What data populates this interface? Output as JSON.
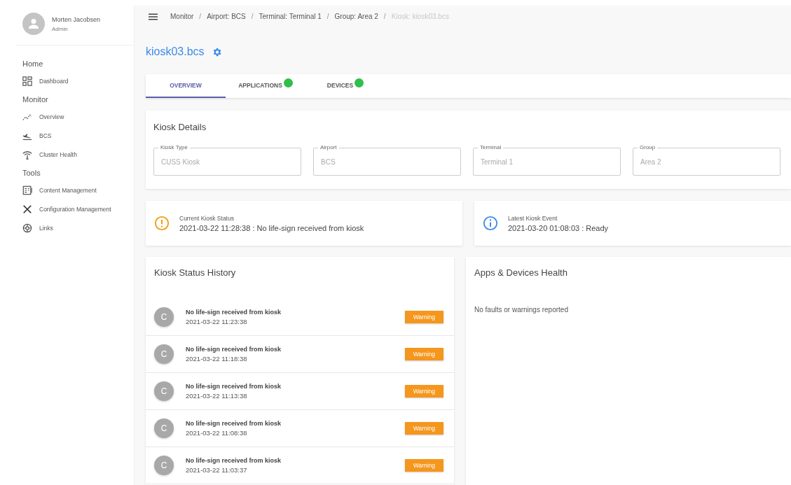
{
  "user": {
    "name": "Morten Jacobsen",
    "role": "Admin"
  },
  "sidebar": {
    "sections": [
      {
        "label": "Home",
        "items": [
          {
            "label": "Dashboard"
          }
        ]
      },
      {
        "label": "Monitor",
        "items": [
          {
            "label": "Overview"
          },
          {
            "label": "BCS"
          },
          {
            "label": "Cluster Health"
          }
        ]
      },
      {
        "label": "Tools",
        "items": [
          {
            "label": "Content Management"
          },
          {
            "label": "Configuration Management"
          },
          {
            "label": "Links"
          }
        ]
      }
    ]
  },
  "breadcrumb": [
    {
      "label": "Monitor",
      "current": false
    },
    {
      "separator": "/",
      "label": "Airport: BCS",
      "current": false
    },
    {
      "separator": "/",
      "label": "Terminal: Terminal 1",
      "current": false
    },
    {
      "separator": "/",
      "label": "Group: Area 2",
      "current": false
    },
    {
      "separator": "/",
      "label": "Kiosk: kiosk03.bcs",
      "current": true
    }
  ],
  "title": "kiosk03.bcs",
  "tabs": [
    {
      "label": "OVERVIEW",
      "selected": true,
      "dot": false
    },
    {
      "label": "APPLICATIONS",
      "selected": false,
      "dot": true
    },
    {
      "label": "DEVICES",
      "selected": false,
      "dot": true
    }
  ],
  "details": {
    "title": "Kiosk Details",
    "fields": [
      {
        "label": "Kiosk Type",
        "value": "CUSS Kiosk"
      },
      {
        "label": "Airport",
        "value": "BCS"
      },
      {
        "label": "Terminal",
        "value": "Terminal 1"
      },
      {
        "label": "Group",
        "value": "Area 2"
      }
    ]
  },
  "status_cards": [
    {
      "kind": "warning",
      "label": "Current Kiosk Status",
      "text": "2021-03-22 11:28:38 : No life-sign received from kiosk"
    },
    {
      "kind": "info",
      "label": "Latest Kiosk Event",
      "text": "2021-03-20 01:08:03 : Ready"
    }
  ],
  "history": {
    "title": "Kiosk Status History",
    "items": [
      {
        "avatar": "C",
        "message": "No life-sign received from kiosk",
        "time": "2021-03-22 11:23:38",
        "badge": "Warning"
      },
      {
        "avatar": "C",
        "message": "No life-sign received from kiosk",
        "time": "2021-03-22 11:18:38",
        "badge": "Warning"
      },
      {
        "avatar": "C",
        "message": "No life-sign received from kiosk",
        "time": "2021-03-22 11:13:38",
        "badge": "Warning"
      },
      {
        "avatar": "C",
        "message": "No life-sign received from kiosk",
        "time": "2021-03-22 11:08:38",
        "badge": "Warning"
      },
      {
        "avatar": "C",
        "message": "No life-sign received from kiosk",
        "time": "2021-03-22 11:03:37",
        "badge": "Warning"
      }
    ]
  },
  "health": {
    "title": "Apps & Devices Health",
    "message": "No faults or warnings reported"
  }
}
